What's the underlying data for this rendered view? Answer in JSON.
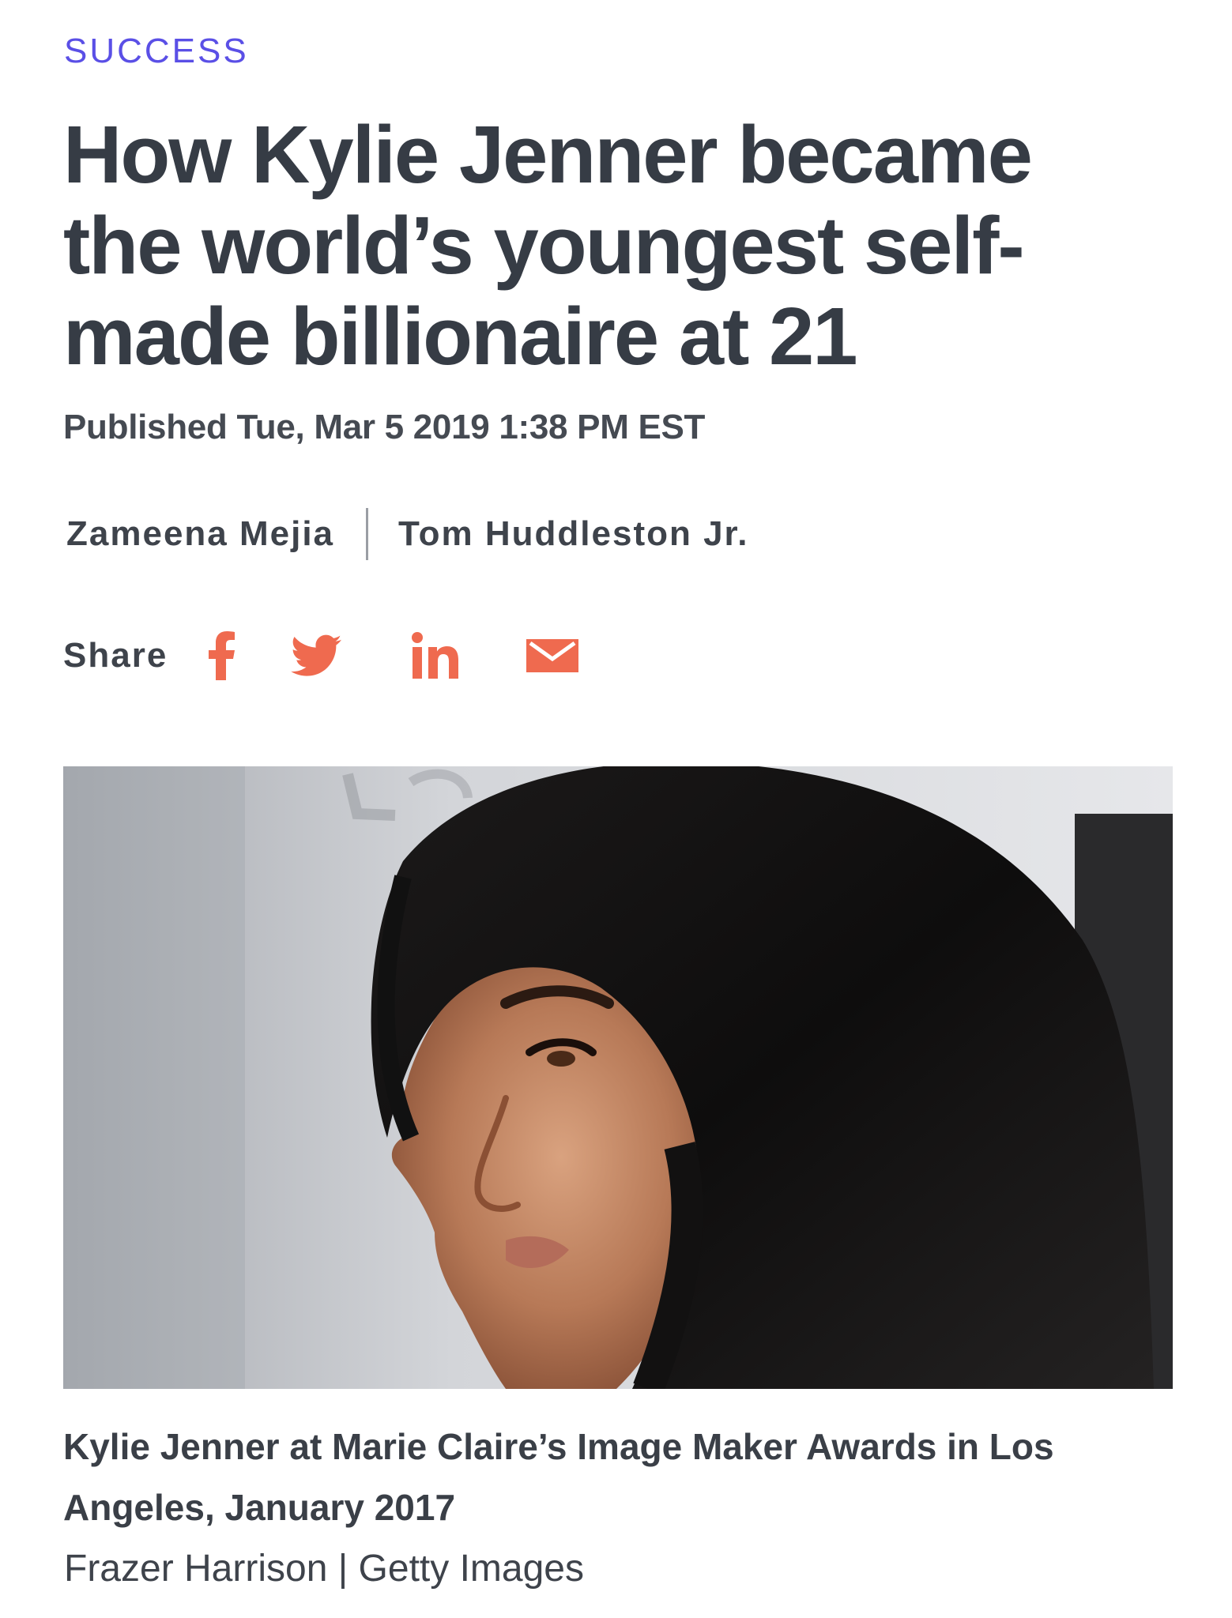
{
  "article": {
    "section": "SUCCESS",
    "headline": "How Kylie Jenner became the world’s youngest self-made billionaire at 21",
    "published": "Published Tue, Mar 5 2019 1:38 PM EST",
    "authors": [
      "Zameena Mejia",
      "Tom Huddleston Jr."
    ]
  },
  "share": {
    "label": "Share",
    "icons": [
      "facebook-icon",
      "twitter-icon",
      "linkedin-icon",
      "email-icon"
    ],
    "icon_color": "#ef6a4f"
  },
  "image": {
    "caption": "Kylie Jenner at Marie Claire’s Image Maker Awards in Los Angeles, January 2017",
    "credit": "Frazer Harrison | Getty Images"
  },
  "colors": {
    "kicker": "#5a4fe6",
    "headline": "#363c45",
    "body_text": "#3a3f47"
  }
}
